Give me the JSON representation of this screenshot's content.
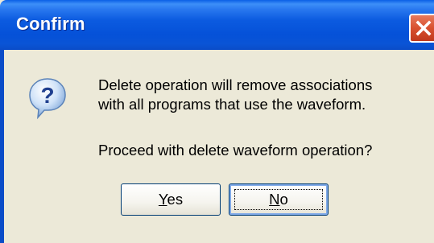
{
  "window": {
    "title": "Confirm"
  },
  "message": {
    "line1": "Delete operation will remove associations",
    "line2": "with all programs that use the waveform.",
    "prompt": "Proceed with delete waveform operation?"
  },
  "buttons": {
    "yes": {
      "accel": "Y",
      "rest": "es"
    },
    "no": {
      "accel": "N",
      "rest": "o"
    }
  },
  "icons": {
    "question": "question-icon",
    "close": "close-icon"
  },
  "colors": {
    "titlebar": "#0A54D6",
    "close": "#D8502F",
    "face": "#ECE9D8"
  }
}
